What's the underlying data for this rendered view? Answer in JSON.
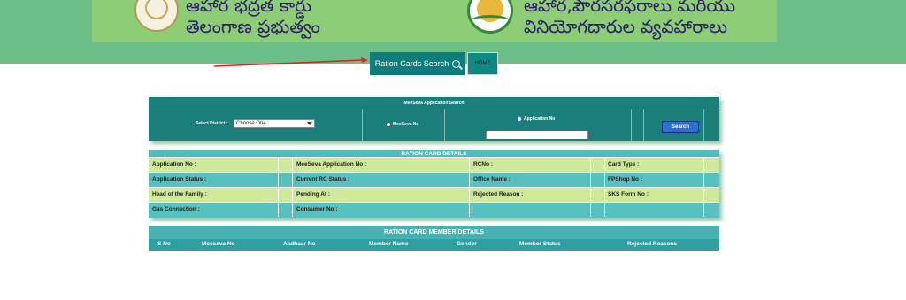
{
  "banner": {
    "left_line1": "ఆహార భద్రత కార్డు",
    "left_line2": "తెలంగాణ ప్రభుత్వం",
    "right_line1": "ఆహార,పౌరసరఫరాలు మరియు",
    "right_line2": "వినియోగదారుల వ్యవహారాలు",
    "left_emblem": "telangana-emblem",
    "right_emblem": "civil-supplies-logo"
  },
  "nav": {
    "search_label": "Ration Cards Search",
    "search_icon": "search-icon",
    "home_label": "HOME"
  },
  "search_panel": {
    "title": "MeeSeva Application Search",
    "district_label": "Select District :",
    "district_value": "Choose One",
    "radio_meeseva_label": "MeeSeva No",
    "radio_application_label": "Application No",
    "selected_radio": "Application No",
    "application_input_value": "",
    "search_button": "Search"
  },
  "ration_card_details": {
    "title": "RATION CARD DETAILS",
    "rows": [
      [
        "Application No :",
        "MeeSeva Application No :",
        "RCNo :",
        "Card Type :"
      ],
      [
        "Application Status :",
        "Current RC Status :",
        "Office Name :",
        "FPShop No :"
      ],
      [
        "Head of the Family :",
        "Pending At :",
        "Rejected Reason :",
        "SKS Form No :"
      ],
      [
        "Gas Connection :",
        "Consumer No :",
        "",
        ""
      ]
    ]
  },
  "member_details": {
    "title": "RATION CARD MEMBER DETAILS",
    "columns": [
      "S No",
      "Meeseva No",
      "Aadhaar No",
      "Member Name",
      "Gender",
      "Member Status",
      "Rejected Reasons"
    ]
  },
  "colors": {
    "top_band": "#6cbf87",
    "banner": "#8dcd76",
    "teal": "#1a7e7a",
    "light_row": "#cfe99b",
    "teal_row": "#57c1c1",
    "arrow": "#e0241b",
    "search_button": "#2c6fd8"
  }
}
